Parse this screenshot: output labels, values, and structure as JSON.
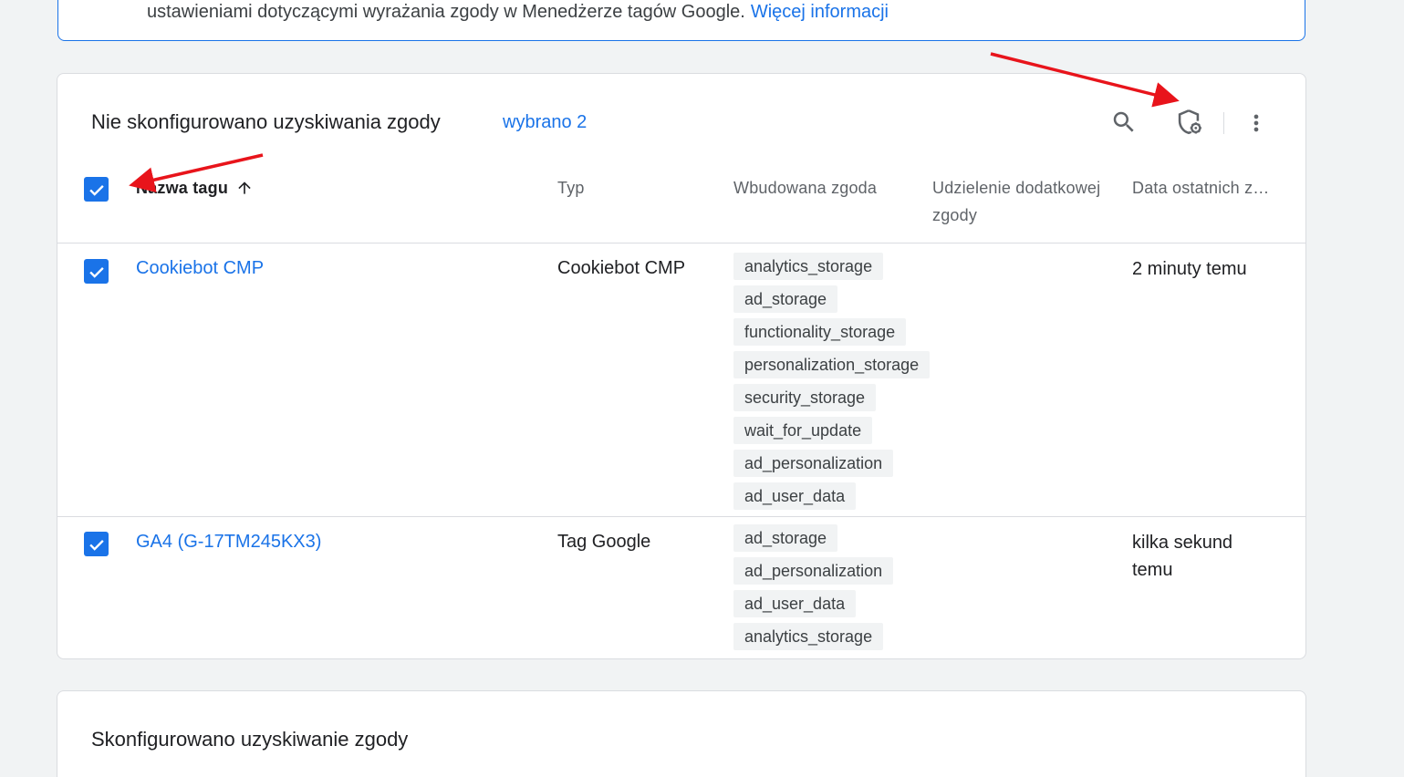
{
  "banner": {
    "text": "ustawieniami dotyczącymi wyrażania zgody w Menedżerze tagów Google.",
    "link": "Więcej informacji"
  },
  "not_configured": {
    "title": "Nie skonfigurowano uzyskiwania zgody",
    "selected": "wybrano 2",
    "toolbar": {
      "search_icon": "search-icon",
      "consent_settings_icon": "shield-gear-icon",
      "more_icon": "more-vert-icon"
    },
    "columns": {
      "name": "Nazwa tagu",
      "type": "Typ",
      "builtin": "Wbudowana zgoda",
      "extra": "Udzielenie dodatkowej zgody",
      "date": "Data ostatnich z…"
    },
    "rows": [
      {
        "name": "Cookiebot CMP",
        "type": "Cookiebot CMP",
        "builtin": [
          "analytics_storage",
          "ad_storage",
          "functionality_storage",
          "personalization_storage",
          "security_storage",
          "wait_for_update",
          "ad_personalization",
          "ad_user_data"
        ],
        "date": "2 minuty temu",
        "checked": true
      },
      {
        "name": "GA4 (G-17TM245KX3)",
        "type": "Tag Google",
        "builtin": [
          "ad_storage",
          "ad_personalization",
          "ad_user_data",
          "analytics_storage"
        ],
        "date": "kilka sekund temu",
        "checked": true
      }
    ]
  },
  "configured": {
    "title": "Skonfigurowano uzyskiwanie zgody"
  },
  "colors": {
    "accent": "#1a73e8",
    "annotation_arrow": "#e8141b"
  }
}
